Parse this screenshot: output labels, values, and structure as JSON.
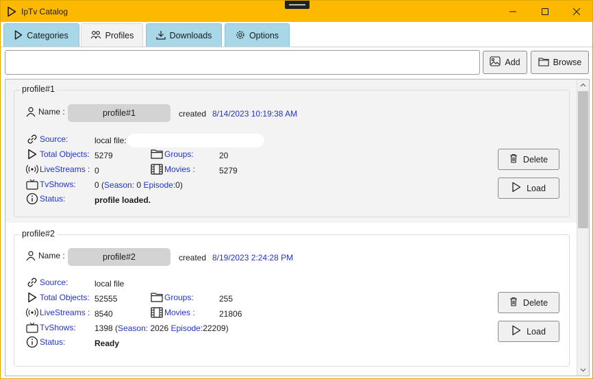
{
  "window": {
    "title": "IpTv Catalog"
  },
  "tabs": [
    {
      "label": "Categories",
      "icon": "play-icon",
      "active": false
    },
    {
      "label": "Profiles",
      "icon": "users-icon",
      "active": true
    },
    {
      "label": "Downloads",
      "icon": "download-icon",
      "active": false
    },
    {
      "label": "Options",
      "icon": "gear-icon",
      "active": false
    }
  ],
  "toolbar": {
    "path_value": "",
    "add_label": "Add",
    "browse_label": "Browse"
  },
  "labels": {
    "name": "Name :",
    "created": "created",
    "source": "Source:",
    "total_objects": "Total Objects:",
    "groups": "Groups:",
    "livestreams": "LiveStreams :",
    "movies": "Movies :",
    "tvshows": "TvShows:",
    "status": "Status:",
    "season": "Season:",
    "episode": "Episode:",
    "delete": "Delete",
    "load": "Load"
  },
  "profiles": [
    {
      "legend": "profile#1",
      "name": "profile#1",
      "created": "8/14/2023 10:19:38 AM",
      "source": "local file:",
      "total_objects": "5279",
      "groups": "20",
      "livestreams": "0",
      "movies": "5279",
      "tvshows": "0",
      "season": "0",
      "episode": "0",
      "status": "profile loaded."
    },
    {
      "legend": "profile#2",
      "name": "profile#2",
      "created": "8/19/2023 2:24:28 PM",
      "source": "local file",
      "total_objects": "52555",
      "groups": "255",
      "livestreams": "8540",
      "movies": "21806",
      "tvshows": "1398",
      "season": "2026",
      "episode": "22209",
      "status": "Ready"
    }
  ],
  "colors": {
    "titlebar": "#fdb900",
    "tab": "#a8d8e8",
    "link": "#2233cc"
  }
}
